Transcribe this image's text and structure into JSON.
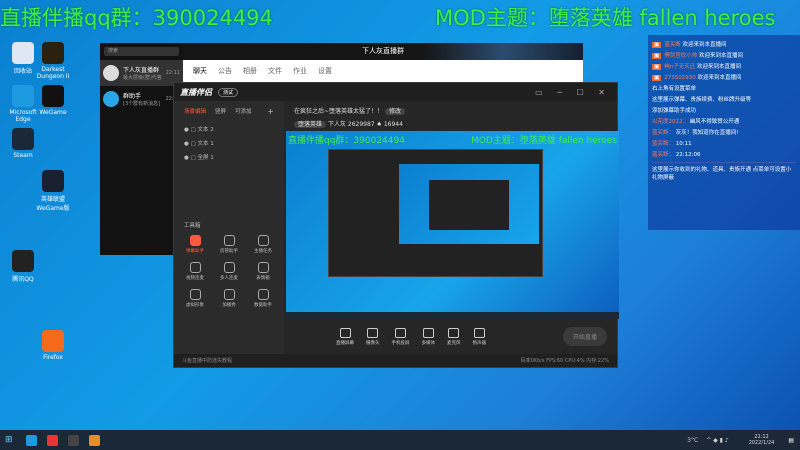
{
  "overlay": {
    "left": "直播伴播qq群：390024494",
    "right": "MOD主题：堕落英雄 fallen heroes"
  },
  "desktop": {
    "icons": [
      {
        "label": "回收站",
        "color": "#dfe8f2"
      },
      {
        "label": "Microsoft Edge",
        "color": "#1e9be0"
      },
      {
        "label": "Steam",
        "color": "#1b2838"
      },
      {
        "label": "WeGame",
        "color": "#111"
      },
      {
        "label": "腾讯QQ",
        "color": "#222"
      },
      {
        "label": "Firefox",
        "color": "#f66a1b"
      },
      {
        "label": "Darkest Dungeon II",
        "color": "#2a2010"
      },
      {
        "label": "英雄联盟WeGame版",
        "color": "#1a2030"
      }
    ]
  },
  "qq": {
    "title": "下人灰直播群",
    "search": "搜索",
    "conversations": [
      {
        "name": "下人灰直播群",
        "time": "22:11",
        "preview": "最大层级(群)代答"
      },
      {
        "name": "群助手",
        "time": "22:07",
        "preview": "[3个群有新消息]"
      }
    ],
    "tabs": [
      "聊天",
      "公告",
      "相册",
      "文件",
      "作业",
      "设置"
    ]
  },
  "zb": {
    "app": "直播伴侣",
    "badge": "测试",
    "scene_tabs": [
      "场景编辑",
      "竖屏",
      "可添加"
    ],
    "layers": [
      "文本 2",
      "文本 1",
      "全屏 1"
    ],
    "stream_title": "在疯狂之后~堕落英雄太猛了！！",
    "edit": "修改",
    "category": "堕落英雄",
    "room_label": "下人灰",
    "room_id": "2629987",
    "likes": "16944",
    "toolbox": "工具箱",
    "tools": [
      "弹幕助手",
      "房管助手",
      "主播任务",
      "视频连麦",
      "多人连麦",
      "表情箱",
      "虚拟形象",
      "加播秀",
      "数据助手"
    ],
    "preview_left": "直播伴播qq群：390024494",
    "preview_right": "MOD主题：堕落英雄 fallen heroes",
    "controls": [
      "直播屏幕",
      "摄像头",
      "手机投屏",
      "多媒体",
      "麦克风",
      "扬声器"
    ],
    "start": "开始直播",
    "status_left": "斗鱼直播中防迷失教程",
    "status_right": "码率0Kb/s  FPS:60  CPU:4%  内存:22%"
  },
  "chat": {
    "messages": [
      {
        "name": "蓝买断",
        "text": "欢迎来到本直播间"
      },
      {
        "name": "傅剑宫纹小帅",
        "text": "欢迎来到本直播间"
      },
      {
        "name": "纯n子无天迁",
        "text": "欢迎来到本直播间"
      },
      {
        "name": "273502930",
        "text": "欢迎来到本直播间"
      }
    ],
    "notice1": "右上角有设置菜单",
    "notice2": "这里展示弹幕、贵族续费、粉丝牌升级等",
    "notice3": "添加弹幕助手成功",
    "sys": [
      {
        "name": "以花度2012：",
        "text": "幽风不得致赞公开通"
      },
      {
        "name": "蓝买断：",
        "text": "灰灰！我知道你在直播间!"
      },
      {
        "name": "蓝买断：",
        "text": "10:11"
      },
      {
        "name": "蓝买断：",
        "text": "22:12:06"
      }
    ],
    "footer": "这里展示你收到的礼物、道具、贵族开通 点菜单可设置小礼物屏蔽"
  },
  "taskbar": {
    "weather": "3°C",
    "time": "22:12",
    "date": "2022/1/24"
  }
}
